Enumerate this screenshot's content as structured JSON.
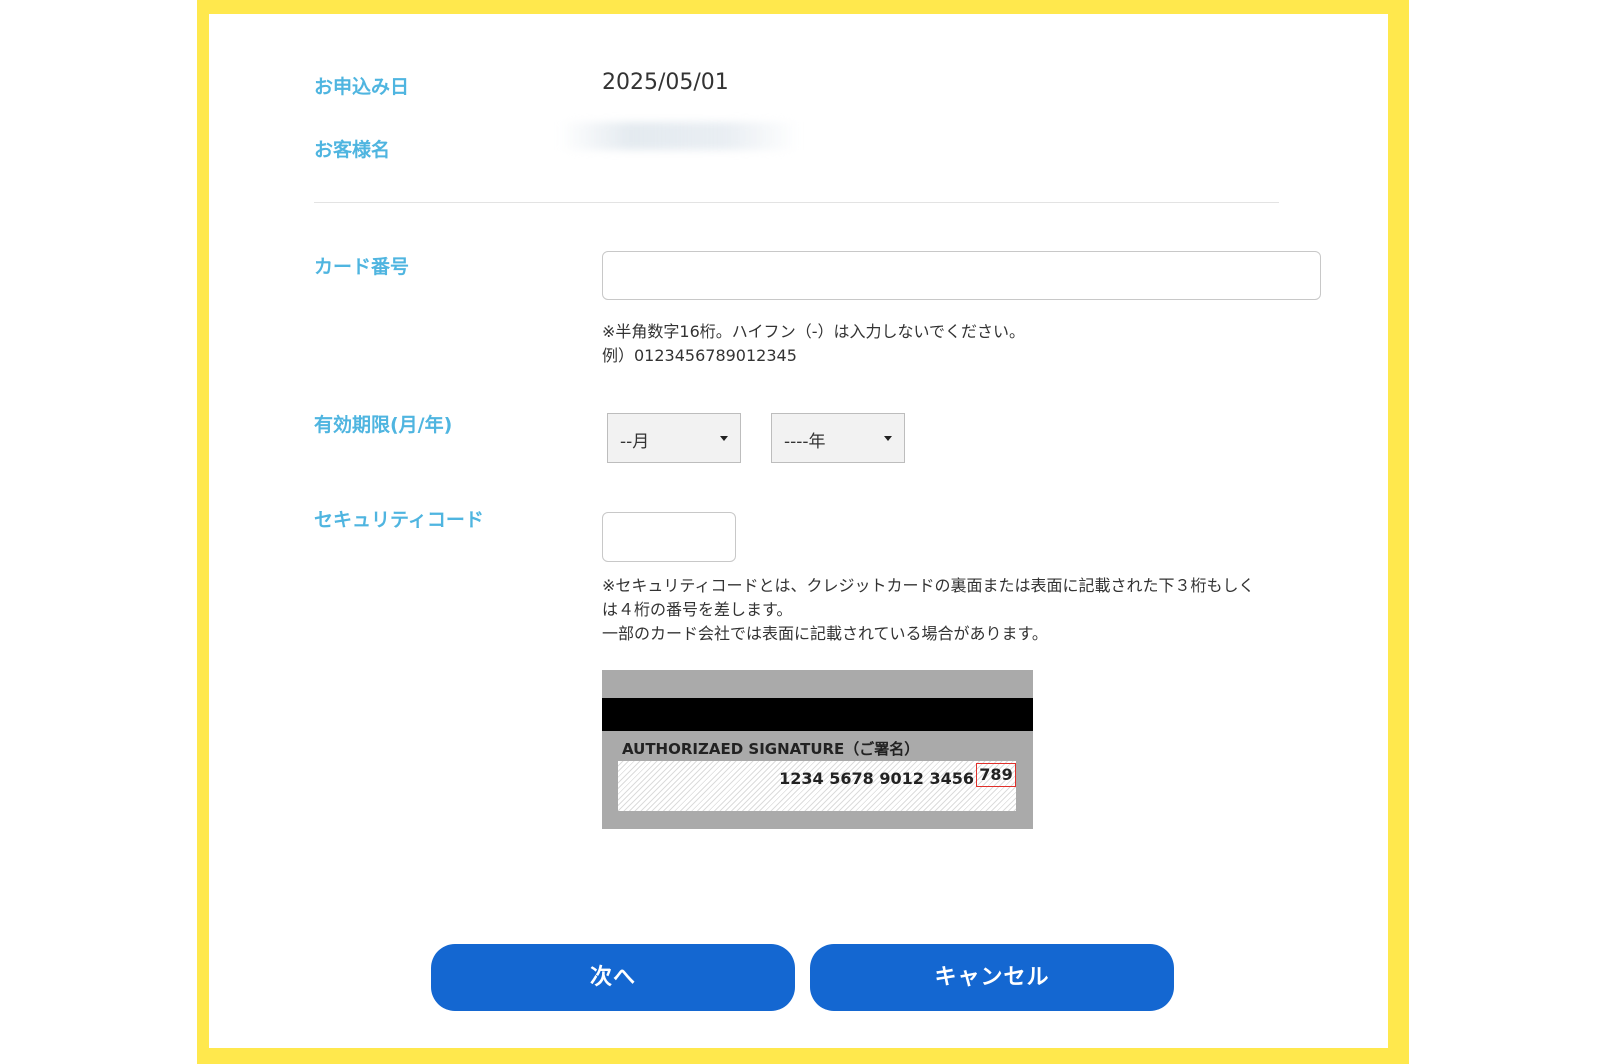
{
  "application": {
    "date_label": "お申込み日",
    "date_value": "2025/05/01",
    "name_label": "お客様名"
  },
  "card_number": {
    "label": "カード番号",
    "value": "",
    "note_line1": "※半角数字16桁。ハイフン（-）は入力しないでください。",
    "note_line2": "例）0123456789012345"
  },
  "expiry": {
    "label": "有効期限(月/年)",
    "month_selected": "--月",
    "year_selected": "----年"
  },
  "security": {
    "label": "セキュリティコード",
    "value": "",
    "note_line1": "※セキュリティコードとは、クレジットカードの裏面または表面に記載された下３桁もしく",
    "note_line2": "は４桁の番号を差します。",
    "note_line3": "一部のカード会社では表面に記載されている場合があります。"
  },
  "card_image": {
    "signature_title": "AUTHORIZAED SIGNATURE（ご署名）",
    "card_number_sample": "1234 5678 9012 3456",
    "cvv_sample": "789"
  },
  "buttons": {
    "next_label": "次へ",
    "cancel_label": "キャンセル"
  },
  "colors": {
    "frame": "#FFE84D",
    "label": "#4FB5E0",
    "button": "#1467D1",
    "cvv_highlight": "#E0302A"
  }
}
